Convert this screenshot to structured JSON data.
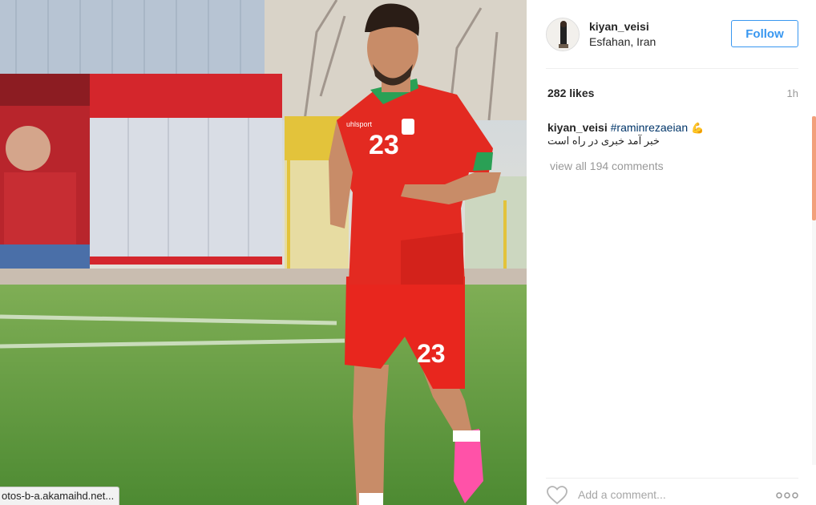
{
  "post": {
    "username": "kiyan_veisi",
    "location": "Esfahan, Iran",
    "follow_label": "Follow",
    "likes": "282 likes",
    "time": "1h",
    "caption_user": "kiyan_veisi",
    "caption_hashtag": "#raminrezaeian",
    "caption_emoji": "💪",
    "caption_line2": "خبر آمد خبری در راه است",
    "view_all": "view all 194 comments",
    "comment_placeholder": "Add a comment...",
    "photo_alt": "Player in red jersey number 23 running on a football pitch"
  },
  "browser": {
    "status_url": "otos-b-a.akamaihd.net..."
  },
  "colors": {
    "link_blue": "#3897f0",
    "hashtag": "#003569",
    "scroll_thumb": "#f2a07b"
  },
  "icons": {
    "like": "heart-outline-icon",
    "more": "more-options-icon"
  }
}
